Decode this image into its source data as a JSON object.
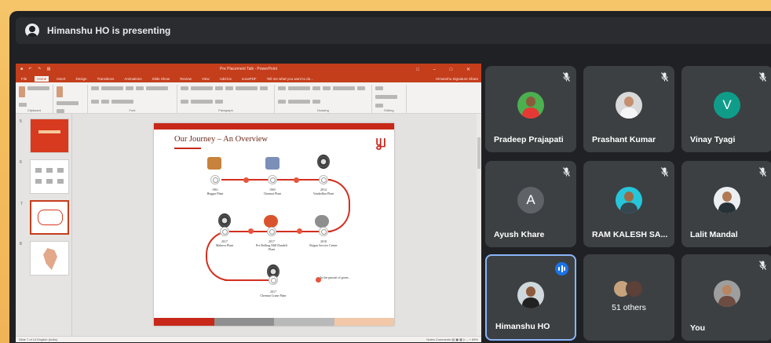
{
  "presenter": {
    "text": "Himanshu HO is presenting",
    "icon": "person-icon"
  },
  "ppt": {
    "window_title": "Pre Placement Talk - PowerPoint",
    "quick_access": "■ ↶ ↷ ▤",
    "window_controls": "□ – □ ✕",
    "tabs": [
      "File",
      "Home",
      "Insert",
      "Design",
      "Transitions",
      "Animations",
      "Slide Show",
      "Review",
      "View",
      "Add-ins",
      "novaPDF",
      "Tell me what you want to do..."
    ],
    "active_tab": "Home",
    "user": "Himanshu Signature  Share",
    "ribbon_groups": [
      "Clipboard",
      "Slides",
      "Font",
      "Paragraph",
      "Drawing",
      "Editing"
    ],
    "slide_numbers": [
      "5",
      "6",
      "7",
      "8"
    ],
    "statusbar_left": "Slide 7 of 14   English (India)",
    "statusbar_right": "Notes   Comments   ▤  ▣  ▦  ▷   –  +  85%"
  },
  "slide": {
    "title": "Our Journey – An Overview",
    "logo": "௶",
    "milestones": [
      {
        "year": "1961",
        "label": "Heggar Plant"
      },
      {
        "year": "1965",
        "label": "Chennai Plant"
      },
      {
        "year": "2014",
        "label": "Vandedhur Plant"
      },
      {
        "year": "2017",
        "label": "Mahuva Plant"
      },
      {
        "year": "2017",
        "label": "Pre Rolling Mill Dandeli Plant"
      },
      {
        "year": "2018",
        "label": "Rajpur Service Center"
      },
      {
        "year": "2017",
        "label": "Chennai Crane Plant"
      }
    ],
    "note": "In the pursuit of green ..",
    "footer_colors": [
      "#c7281a",
      "#8f8f8f",
      "#b9b9b9",
      "#f2c8a8"
    ]
  },
  "participants": [
    {
      "name": "Pradeep Prajapati",
      "type": "photo",
      "skin": "#8a5a3a",
      "shirt": "#e53935",
      "bg": "#4caf50",
      "muted": true
    },
    {
      "name": "Prashant Kumar",
      "type": "photo",
      "skin": "#c49070",
      "shirt": "#f5f5f5",
      "bg": "#d9d9d9",
      "muted": true
    },
    {
      "name": "Vinay Tyagi",
      "type": "letter",
      "letter": "V",
      "color": "#0f9d8a",
      "muted": true
    },
    {
      "name": "Ayush Khare",
      "type": "letter",
      "letter": "A",
      "color": "#5f6368",
      "muted": true
    },
    {
      "name": "RAM KALESH SA...",
      "type": "photo",
      "skin": "#9c6b45",
      "shirt": "#37474f",
      "bg": "#26c6da",
      "muted": true
    },
    {
      "name": "Lalit Mandal",
      "type": "photo",
      "skin": "#b07a55",
      "shirt": "#263238",
      "bg": "#eceff1",
      "muted": true
    },
    {
      "name": "Himanshu HO",
      "type": "photo",
      "skin": "#8d5a3a",
      "shirt": "#212121",
      "bg": "#cfd8dc",
      "muted": false,
      "speaking": true
    },
    {
      "name": "51 others",
      "type": "others"
    },
    {
      "name": "You",
      "type": "photo",
      "skin": "#b88660",
      "shirt": "#6d4c41",
      "bg": "#9e9e9e",
      "muted": true
    }
  ]
}
